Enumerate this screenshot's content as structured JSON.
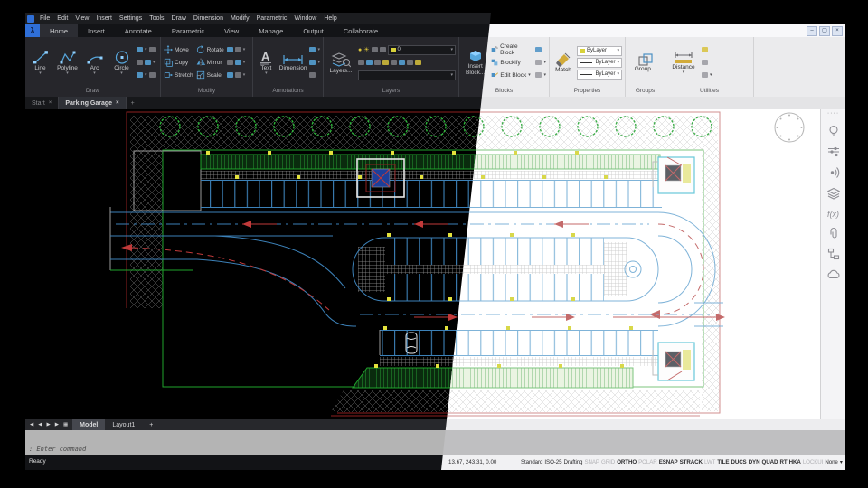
{
  "window": {
    "minimize": "–",
    "restore": "▢",
    "close": "×"
  },
  "menubar": {
    "items": [
      "File",
      "Edit",
      "View",
      "Insert",
      "Settings",
      "Tools",
      "Draw",
      "Dimension",
      "Modify",
      "Parametric",
      "Window",
      "Help"
    ]
  },
  "ribbon_tabs": {
    "items": [
      "Home",
      "Insert",
      "Annotate",
      "Parametric",
      "View",
      "Manage",
      "Output",
      "Collaborate"
    ],
    "active": "Home"
  },
  "panels": {
    "draw": {
      "label": "Draw",
      "tools": [
        "Line",
        "Polyline",
        "Arc",
        "Circle"
      ]
    },
    "modify": {
      "label": "Modify",
      "tools": [
        "Move",
        "Copy",
        "Stretch",
        "Rotate",
        "Mirror",
        "Scale"
      ]
    },
    "annotations": {
      "label": "Annotations",
      "tools": [
        "Text",
        "Dimension"
      ]
    },
    "layers": {
      "label": "Layers",
      "button": "Layers...",
      "layer_select": "0"
    },
    "blocks": {
      "label": "Blocks",
      "insert": "Insert Block...",
      "items": [
        "Create Block",
        "Blockify",
        "Edit Block"
      ]
    },
    "properties": {
      "label": "Properties",
      "match": "Match",
      "selects": [
        "ByLayer",
        "ByLayer",
        "ByLayer"
      ]
    },
    "groups": {
      "label": "Groups",
      "button": "Group..."
    },
    "utilities": {
      "label": "Utilities",
      "distance": "Distance"
    }
  },
  "doc_tabs": {
    "start": "Start",
    "drawing": "Parking Garage",
    "close": "×",
    "add": "+"
  },
  "layout_bar": {
    "nav": [
      "◀",
      "◀",
      "▶",
      "▶"
    ],
    "model": "Model",
    "layout1": "Layout1",
    "add": "+"
  },
  "command": {
    "prompt": ": Enter command"
  },
  "status": {
    "ready": "Ready",
    "coords": "13.67, 243.31, 0.00",
    "items": [
      {
        "label": "Standard",
        "state": "normal"
      },
      {
        "label": "ISO-25",
        "state": "normal"
      },
      {
        "label": "Drafting",
        "state": "normal"
      },
      {
        "label": "SNAP",
        "state": "off"
      },
      {
        "label": "GRID",
        "state": "off"
      },
      {
        "label": "ORTHO",
        "state": "on"
      },
      {
        "label": "POLAR",
        "state": "off"
      },
      {
        "label": "ESNAP",
        "state": "on"
      },
      {
        "label": "STRACK",
        "state": "on"
      },
      {
        "label": "LWT",
        "state": "off"
      },
      {
        "label": "TILE",
        "state": "on"
      },
      {
        "label": "DUCS",
        "state": "on"
      },
      {
        "label": "DYN",
        "state": "on"
      },
      {
        "label": "QUAD",
        "state": "on"
      },
      {
        "label": "RT",
        "state": "on"
      },
      {
        "label": "HKA",
        "state": "on"
      },
      {
        "label": "LOCKUI",
        "state": "off"
      },
      {
        "label": "None",
        "state": "normal"
      }
    ]
  },
  "sidebar_icons": [
    "grip-dots",
    "tips-lightbulb",
    "settings-sliders",
    "render-waves",
    "layers-stack",
    "fields-fx",
    "attachments-paperclip",
    "structure-tree",
    "cloud"
  ],
  "icon_glyphs": {
    "fx": "f(x)",
    "sun": "☀",
    "bulb": "●",
    "dropdown": "▾",
    "grip": "····"
  },
  "theme_colors": {
    "dark_canvas": "#000000",
    "light_canvas": "#ffffff",
    "cad_blue": "#3c81b8",
    "cad_red": "#c13a3a",
    "cad_green": "#2db83a",
    "cad_yellow": "#e3e23c",
    "logo_blue": "#2f6fd8"
  },
  "drawing_name": "Parking Garage"
}
